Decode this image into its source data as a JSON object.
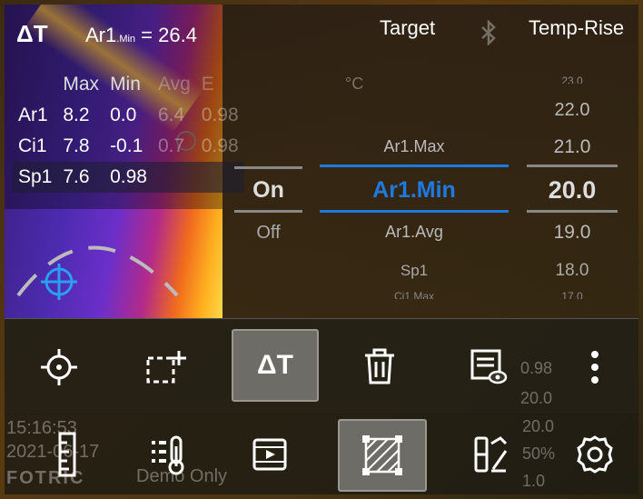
{
  "header": {
    "delta_icon": "ΔT",
    "measure_title": "Ar1",
    "measure_sub": "Min",
    "measure_value": "= 26.4",
    "target_label": "Target",
    "temp_rise_label": "Temp-Rise",
    "unit": "°C"
  },
  "table": {
    "headers": [
      "Max",
      "Min",
      "Avg",
      "E"
    ],
    "rows": [
      {
        "name": "Ar1",
        "max": "8.2",
        "min": "0.0",
        "avg": "6.4",
        "e": "0.98"
      },
      {
        "name": "Ci1",
        "max": "7.8",
        "min": "-0.1",
        "avg": "0.7",
        "e": "0.98"
      },
      {
        "name": "Sp1",
        "max": "7.6",
        "min": "0.98",
        "avg": "",
        "e": ""
      }
    ]
  },
  "picker": {
    "toggle": {
      "selected": "On",
      "below": "Off"
    },
    "target": {
      "above": "Ar1.Max",
      "selected": "Ar1.Min",
      "below1": "Ar1.Avg",
      "below2": "Sp1",
      "below3": "Ci1.Max"
    },
    "temp": {
      "above2": "23.0",
      "above1": "22.0",
      "above0": "21.0",
      "selected": "20.0",
      "below1": "19.0",
      "below2": "18.0",
      "below3": "17.0"
    }
  },
  "toolbar_top": [
    "crosshair-tool",
    "add-area-tool",
    "delta-t-tool",
    "delete-tool",
    "view-tool",
    "more-menu"
  ],
  "toolbar_bottom": [
    "ruler-tool",
    "palette-tool",
    "video-tool",
    "area-fill-tool",
    "compare-tool",
    "settings"
  ],
  "background": {
    "time": "15:16:53",
    "date": "2021-06-17",
    "brand": "FOTRIC",
    "demo": "Demo Only",
    "side_values": [
      "0.98",
      "20.0",
      "20.0",
      "50%",
      "1.0"
    ]
  },
  "colors": {
    "accent_blue": "#1f7ae0"
  }
}
